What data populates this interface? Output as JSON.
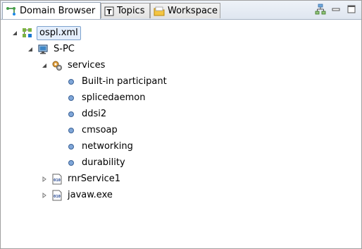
{
  "tabs": [
    {
      "label": "Domain Browser",
      "icon": "domain-browser-icon",
      "active": true
    },
    {
      "label": "Topics",
      "icon": "topics-icon",
      "active": false
    },
    {
      "label": "Workspace",
      "icon": "workspace-icon",
      "active": false
    }
  ],
  "toolbar": {
    "icons": [
      "hierarchy-icon",
      "minimize-icon",
      "maximize-icon"
    ]
  },
  "tree": {
    "root": {
      "label": "ospl.xml",
      "expanded": true,
      "selected": true
    },
    "node": {
      "label": "S-PC",
      "expanded": true
    },
    "services": {
      "label": "services",
      "expanded": true
    },
    "service_items": [
      {
        "label": "Built-in participant"
      },
      {
        "label": "splicedaemon"
      },
      {
        "label": "ddsi2"
      },
      {
        "label": "cmsoap"
      },
      {
        "label": "networking"
      },
      {
        "label": "durability"
      }
    ],
    "processes": [
      {
        "label": "rnrService1",
        "expanded": false
      },
      {
        "label": "javaw.exe",
        "expanded": false
      }
    ]
  },
  "colors": {
    "selection_bg": "#e4eefc",
    "selection_border": "#7da2ce",
    "bullet": "#5b7fb0"
  }
}
